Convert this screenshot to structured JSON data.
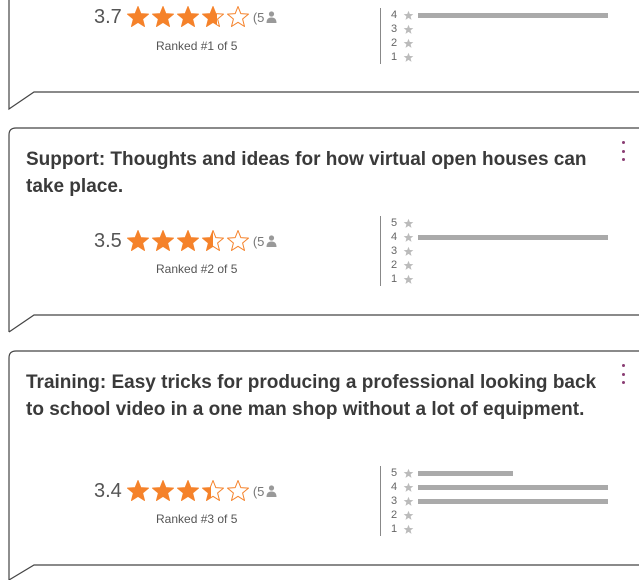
{
  "colors": {
    "star_filled": "#f5822a",
    "menu_dots": "#8a3d73",
    "bar": "#aaaaaa",
    "border": "#444444"
  },
  "cards": [
    {
      "title": "",
      "average": "3.7",
      "star_fill": [
        1,
        1,
        1,
        0.7,
        0
      ],
      "votes": "(5",
      "ranked": "Ranked #1 of 5",
      "distribution": [
        {
          "label": "4",
          "fraction": 1.0
        },
        {
          "label": "3",
          "fraction": 0
        },
        {
          "label": "2",
          "fraction": 0
        },
        {
          "label": "1",
          "fraction": 0
        }
      ]
    },
    {
      "title": "Support: Thoughts and ideas for how virtual open houses can take place.",
      "average": "3.5",
      "star_fill": [
        1,
        1,
        1,
        0.5,
        0
      ],
      "votes": "(5",
      "ranked": "Ranked #2 of 5",
      "distribution": [
        {
          "label": "5",
          "fraction": 0
        },
        {
          "label": "4",
          "fraction": 1.0
        },
        {
          "label": "3",
          "fraction": 0
        },
        {
          "label": "2",
          "fraction": 0
        },
        {
          "label": "1",
          "fraction": 0
        }
      ]
    },
    {
      "title": "Training: Easy tricks for producing a professional looking back to school video in a one man shop without a lot of equipment.",
      "average": "3.4",
      "star_fill": [
        1,
        1,
        1,
        0.4,
        0
      ],
      "votes": "(5",
      "ranked": "Ranked #3 of 5",
      "distribution": [
        {
          "label": "5",
          "fraction": 0.5
        },
        {
          "label": "4",
          "fraction": 1.0
        },
        {
          "label": "3",
          "fraction": 1.0
        },
        {
          "label": "2",
          "fraction": 0
        },
        {
          "label": "1",
          "fraction": 0
        }
      ]
    }
  ]
}
